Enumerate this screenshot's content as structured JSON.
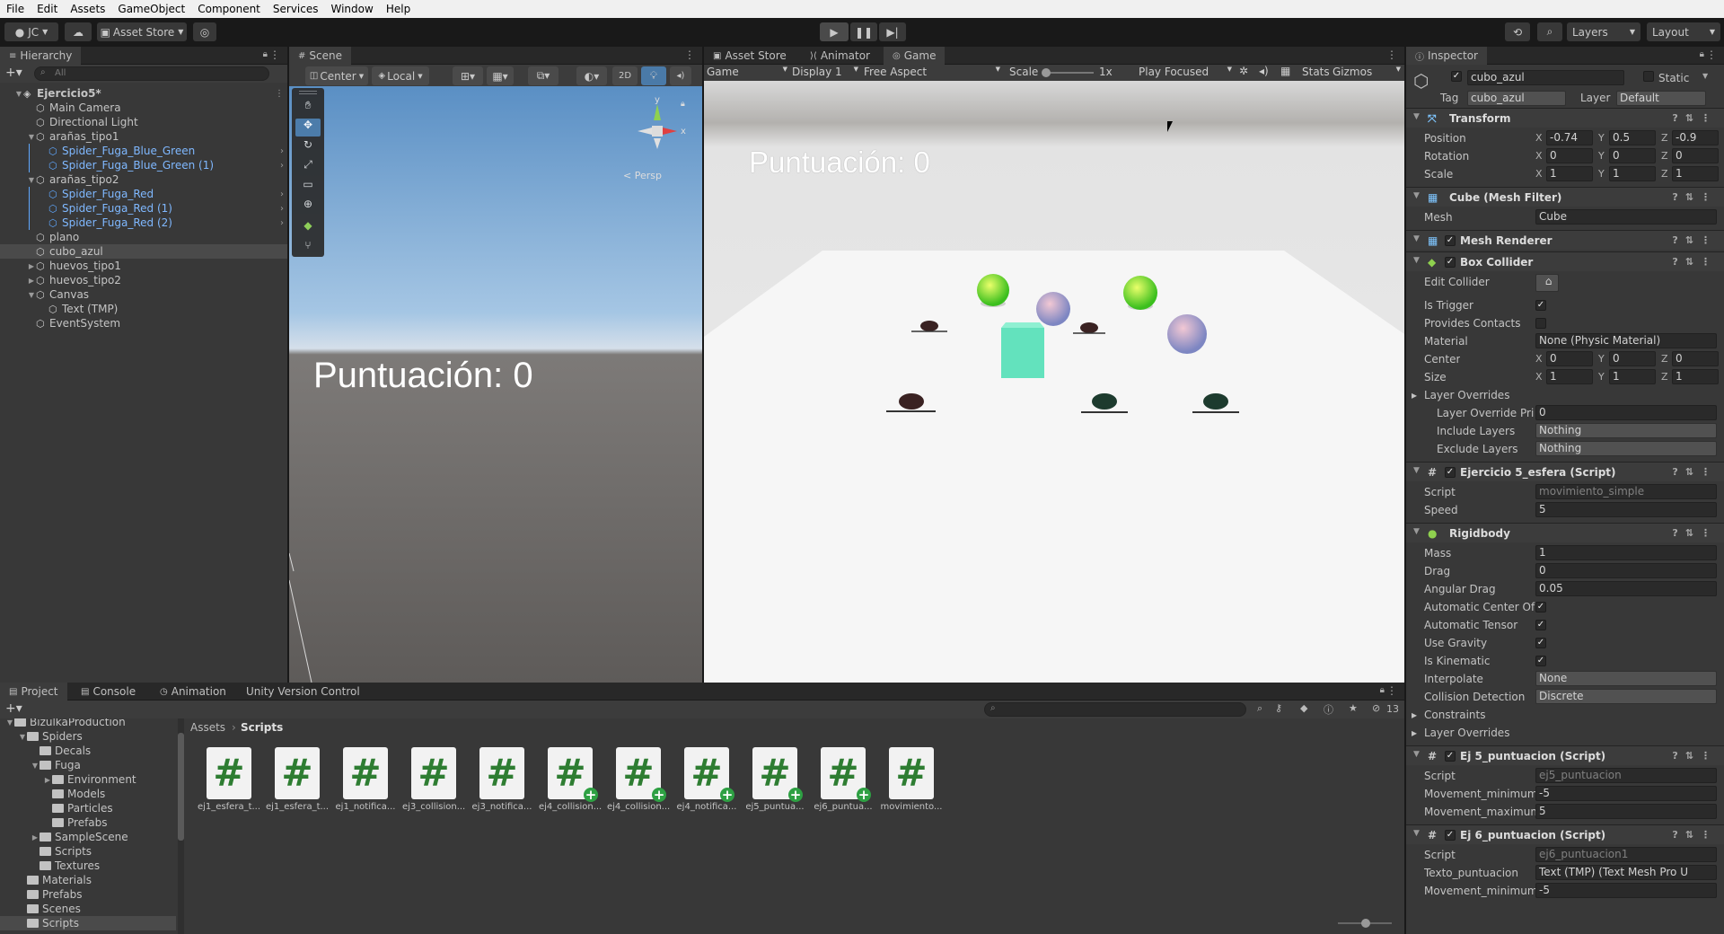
{
  "menubar": [
    "File",
    "Edit",
    "Assets",
    "GameObject",
    "Component",
    "Services",
    "Window",
    "Help"
  ],
  "toolbar": {
    "account": "JC",
    "asset_store": "Asset Store",
    "layers": "Layers",
    "layout": "Layout"
  },
  "hierarchy": {
    "tab": "Hierarchy",
    "search_placeholder": "All",
    "items": [
      {
        "label": "Ejercicio5*",
        "depth": 0
      },
      {
        "label": "Main Camera",
        "depth": 1
      },
      {
        "label": "Directional Light",
        "depth": 1
      },
      {
        "label": "arañas_tipo1",
        "depth": 1
      },
      {
        "label": "Spider_Fuga_Blue_Green",
        "depth": 2
      },
      {
        "label": "Spider_Fuga_Blue_Green (1)",
        "depth": 2
      },
      {
        "label": "arañas_tipo2",
        "depth": 1
      },
      {
        "label": "Spider_Fuga_Red",
        "depth": 2
      },
      {
        "label": "Spider_Fuga_Red (1)",
        "depth": 2
      },
      {
        "label": "Spider_Fuga_Red (2)",
        "depth": 2
      },
      {
        "label": "plano",
        "depth": 1
      },
      {
        "label": "cubo_azul",
        "depth": 1
      },
      {
        "label": "huevos_tipo1",
        "depth": 1
      },
      {
        "label": "huevos_tipo2",
        "depth": 1
      },
      {
        "label": "Canvas",
        "depth": 1
      },
      {
        "label": "Text (TMP)",
        "depth": 2
      },
      {
        "label": "EventSystem",
        "depth": 1
      }
    ]
  },
  "scene": {
    "tab": "Scene",
    "center": "Center",
    "local": "Local",
    "mode_2d": "2D",
    "persp": "< Persp",
    "score_text": "Puntuación: 0",
    "gizmo_y": "y",
    "gizmo_x": "x"
  },
  "game": {
    "tabs": [
      "Asset Store",
      "Animator",
      "Game"
    ],
    "display_mode": "Game",
    "display": "Display 1",
    "aspect": "Free Aspect",
    "scale_label": "Scale",
    "scale_value": "1x",
    "play_focused": "Play Focused",
    "stats": "Stats",
    "gizmos": "Gizmos",
    "score_text": "Puntuación: 0"
  },
  "inspector": {
    "tab": "Inspector",
    "object_name": "cubo_azul",
    "static": "Static",
    "tag_label": "Tag",
    "tag": "cubo_azul",
    "layer_label": "Layer",
    "layer": "Default",
    "transform": {
      "title": "Transform",
      "position": {
        "label": "Position",
        "x": "-0.74",
        "y": "0.5",
        "z": "-0.9"
      },
      "rotation": {
        "label": "Rotation",
        "x": "0",
        "y": "0",
        "z": "0"
      },
      "scale": {
        "label": "Scale",
        "x": "1",
        "y": "1",
        "z": "1"
      }
    },
    "mesh_filter": {
      "title": "Cube (Mesh Filter)",
      "mesh_label": "Mesh",
      "mesh": "Cube"
    },
    "mesh_renderer": {
      "title": "Mesh Renderer"
    },
    "box_collider": {
      "title": "Box Collider",
      "edit_collider": "Edit Collider",
      "is_trigger": "Is Trigger",
      "provides_contacts": "Provides Contacts",
      "material_label": "Material",
      "material": "None (Physic Material)",
      "center": {
        "label": "Center",
        "x": "0",
        "y": "0",
        "z": "0"
      },
      "size": {
        "label": "Size",
        "x": "1",
        "y": "1",
        "z": "1"
      },
      "layer_overrides": "Layer Overrides",
      "layer_override_priority_label": "Layer Override Pri",
      "layer_override_priority": "0",
      "include_layers_label": "Include Layers",
      "include_layers": "Nothing",
      "exclude_layers_label": "Exclude Layers",
      "exclude_layers": "Nothing"
    },
    "script1": {
      "title": "Ejercicio 5_esfera (Script)",
      "script_label": "Script",
      "script": "movimiento_simple",
      "speed_label": "Speed",
      "speed": "5"
    },
    "rigidbody": {
      "title": "Rigidbody",
      "mass_label": "Mass",
      "mass": "1",
      "drag_label": "Drag",
      "drag": "0",
      "angular_drag_label": "Angular Drag",
      "angular_drag": "0.05",
      "auto_center_label": "Automatic Center Of",
      "auto_tensor_label": "Automatic Tensor",
      "use_gravity_label": "Use Gravity",
      "is_kinematic_label": "Is Kinematic",
      "interpolate_label": "Interpolate",
      "interpolate": "None",
      "collision_label": "Collision Detection",
      "collision": "Discrete",
      "constraints": "Constraints",
      "layer_overrides": "Layer Overrides"
    },
    "script2": {
      "title": "Ej 5_puntuacion (Script)",
      "script_label": "Script",
      "script": "ej5_puntuacion",
      "min_label": "Movement_minimum",
      "min": "-5",
      "max_label": "Movement_maximum",
      "max": "5"
    },
    "script3": {
      "title": "Ej 6_puntuacion (Script)",
      "script_label": "Script",
      "script": "ej6_puntuacion1",
      "texto_label": "Texto_puntuacion",
      "texto": "Text (TMP) (Text Mesh Pro U",
      "min_label": "Movement_minimum",
      "min": "-5"
    }
  },
  "project": {
    "tabs": [
      "Project",
      "Console",
      "Animation",
      "Unity Version Control"
    ],
    "hidden_count": "13",
    "breadcrumb_root": "Assets",
    "breadcrumb_current": "Scripts",
    "tree": [
      {
        "label": "BizulkaProduction",
        "depth": 0
      },
      {
        "label": "Spiders",
        "depth": 1
      },
      {
        "label": "Decals",
        "depth": 2
      },
      {
        "label": "Fuga",
        "depth": 2
      },
      {
        "label": "Environment",
        "depth": 3
      },
      {
        "label": "Models",
        "depth": 3
      },
      {
        "label": "Particles",
        "depth": 3
      },
      {
        "label": "Prefabs",
        "depth": 3
      },
      {
        "label": "SampleScene",
        "depth": 2
      },
      {
        "label": "Scripts",
        "depth": 2
      },
      {
        "label": "Textures",
        "depth": 2
      },
      {
        "label": "Materials",
        "depth": 0
      },
      {
        "label": "Prefabs",
        "depth": 0
      },
      {
        "label": "Scenes",
        "depth": 0
      },
      {
        "label": "Scripts",
        "depth": 0
      }
    ],
    "assets": [
      {
        "name": "ej1_esfera_t...",
        "plus": false
      },
      {
        "name": "ej1_esfera_t...",
        "plus": false
      },
      {
        "name": "ej1_notifica...",
        "plus": false
      },
      {
        "name": "ej3_collision...",
        "plus": false
      },
      {
        "name": "ej3_notifica...",
        "plus": false
      },
      {
        "name": "ej4_collision...",
        "plus": true
      },
      {
        "name": "ej4_collision...",
        "plus": true
      },
      {
        "name": "ej4_notifica...",
        "plus": true
      },
      {
        "name": "ej5_puntua...",
        "plus": true
      },
      {
        "name": "ej6_puntua...",
        "plus": true
      },
      {
        "name": "movimiento...",
        "plus": false
      }
    ]
  },
  "colors": {
    "accent_blue": "#7fb8ff",
    "script_green": "#2e7d32"
  }
}
